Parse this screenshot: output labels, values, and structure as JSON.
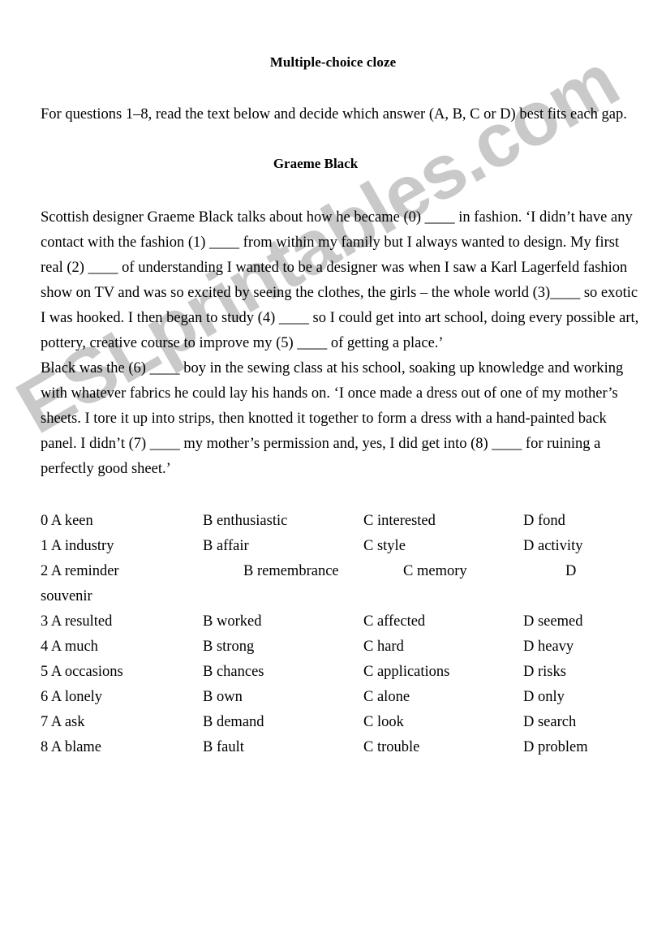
{
  "document": {
    "title": "Multiple-choice cloze",
    "instructions": "For questions 1–8, read the text below and decide which answer (A, B, C or D) best fits each gap.",
    "passage_title": "Graeme Black",
    "passage_lines": [
      "Scottish designer Graeme Black talks about how he became (0) ____ in fashion. ‘I didn’t have any",
      "contact with the fashion (1) ____ from within my family but I always wanted to design. My first",
      "real (2) ____ of understanding I wanted to be a designer was when I saw a Karl Lagerfeld fashion",
      "show on TV and was so excited by seeing the clothes, the girls – the whole world (3)____ so exotic",
      "I was hooked. I then began to study (4) ____ so I could get into art school, doing every possible art,",
      "pottery, creative course to improve my (5) ____ of getting a place.’",
      "Black was the (6) ____ boy in the sewing class at his school, soaking up knowledge and working",
      "with whatever fabrics he could lay his hands on. ‘I once made a dress out of one of my mother’s",
      "sheets. I tore it up into strips, then knotted it together to form a dress with a hand-painted back",
      "panel. I didn’t (7) ____ my mother’s permission and, yes, I did get into (8) ____ for ruining a",
      "perfectly good sheet.’"
    ],
    "watermark": "ESLprintables.com",
    "watermark_color": "#c9c9c9"
  },
  "options": [
    {
      "a": "0 A keen",
      "b": "B enthusiastic",
      "c": "C interested",
      "d": "D fond",
      "wrap": ""
    },
    {
      "a": "1 A industry",
      "b": "B affair",
      "c": "C style",
      "d": "D activity",
      "wrap": ""
    },
    {
      "a": "2 A reminder",
      "b": "B remembrance",
      "c": "C memory",
      "d": "D",
      "wrap": "souvenir"
    },
    {
      "a": "3 A resulted",
      "b": "B worked",
      "c": "C affected",
      "d": "D seemed",
      "wrap": ""
    },
    {
      "a": "4 A much",
      "b": "B strong",
      "c": "C hard",
      "d": "D heavy",
      "wrap": ""
    },
    {
      "a": "5 A occasions",
      "b": "B chances",
      "c": "C applications",
      "d": "D risks",
      "wrap": ""
    },
    {
      "a": "6 A lonely",
      "b": "B own",
      "c": "C alone",
      "d": "D only",
      "wrap": ""
    },
    {
      "a": "7 A ask",
      "b": "B demand",
      "c": "C look",
      "d": "D search",
      "wrap": ""
    },
    {
      "a": "8 A blame",
      "b": "B fault",
      "c": "C trouble",
      "d": "D problem",
      "wrap": ""
    }
  ]
}
